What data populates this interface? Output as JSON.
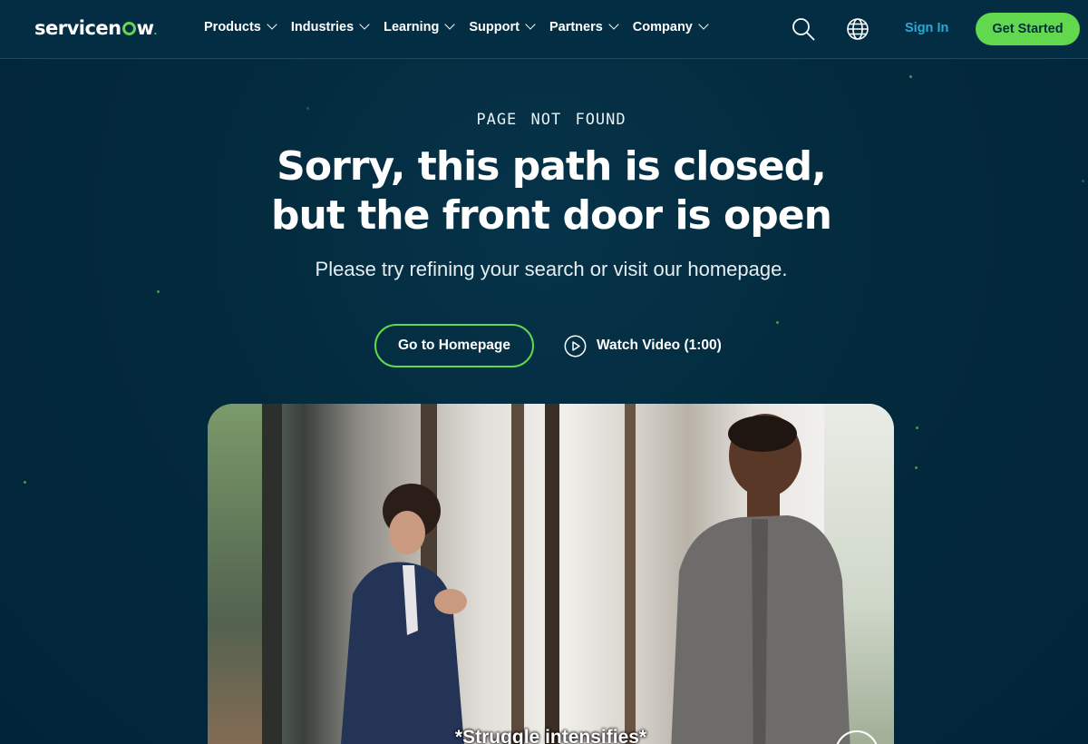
{
  "brand": {
    "logo_text_start": "servicen",
    "logo_text_end": "w",
    "logo_dot": ".",
    "accent_color": "#62d84e",
    "background_color": "#032d42",
    "link_color": "#2aa8d8"
  },
  "nav": {
    "items": [
      {
        "label": "Products",
        "icon": "chevron-down-icon"
      },
      {
        "label": "Industries",
        "icon": "chevron-down-icon"
      },
      {
        "label": "Learning",
        "icon": "chevron-down-icon"
      },
      {
        "label": "Support",
        "icon": "chevron-down-icon"
      },
      {
        "label": "Partners",
        "icon": "chevron-down-icon"
      },
      {
        "label": "Company",
        "icon": "chevron-down-icon"
      }
    ],
    "search_icon": "search-icon",
    "language_icon": "globe-icon",
    "sign_in_label": "Sign In",
    "get_started_label": "Get Started"
  },
  "hero": {
    "eyebrow": "PAGE NOT FOUND",
    "headline_line1": "Sorry, this path is closed,",
    "headline_line2": "but the front door is open",
    "subhead": "Please try refining your search or visit our homepage.",
    "primary_button_label": "Go to Homepage",
    "video_button_label": "Watch Video (1:00)",
    "video_button_icon": "play-circle-icon"
  },
  "video": {
    "caption": "*Struggle intensifies*",
    "control_icon": "pause-circle-icon"
  }
}
